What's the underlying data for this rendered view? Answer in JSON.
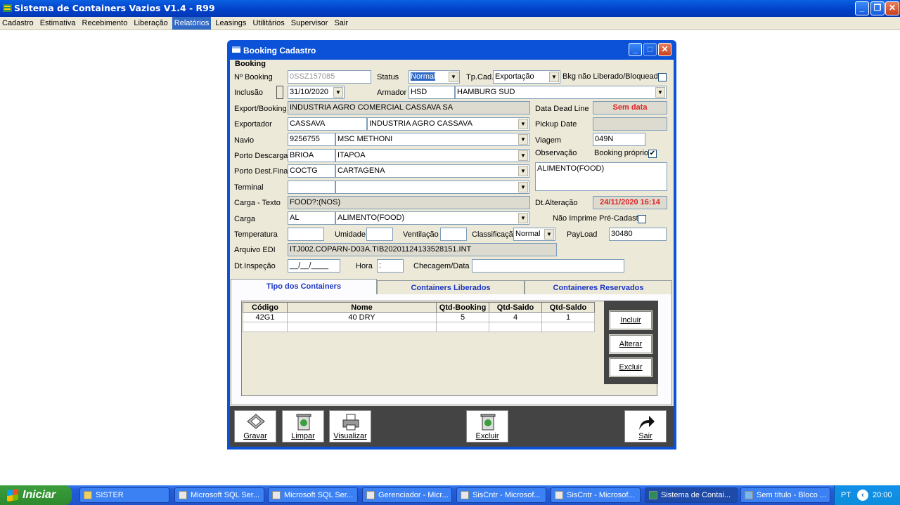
{
  "app": {
    "title": "Sistema de Containers Vazios V1.4 - R99"
  },
  "menu": [
    "Cadastro",
    "Estimativa",
    "Recebimento",
    "Liberação",
    "Relatórios",
    "Leasings",
    "Utilitários",
    "Supervisor",
    "Sair"
  ],
  "dialog": {
    "title": "Booking Cadastro",
    "group": "Booking"
  },
  "form": {
    "booking_label": "Nº Booking",
    "booking": "0SSZ157085",
    "status_label": "Status",
    "status": "Normal",
    "tpcad_label": "Tp.Cad.",
    "tpcad": "Exportação",
    "bkg_label": "Bkg não Liberado/Bloqueado",
    "inclusao_label": "Inclusão",
    "inclusao": "31/10/2020",
    "armador_label": "Armador",
    "armador_code": "HSD",
    "armador_name": "HAMBURG SUD",
    "export_label": "Export/Booking",
    "export": "INDUSTRIA AGRO COMERCIAL CASSAVA SA",
    "deadline_label": "Data Dead Line",
    "deadline": "Sem data",
    "exportador_label": "Exportador",
    "exportador_code": "CASSAVA",
    "exportador_name": "INDUSTRIA AGRO CASSAVA",
    "pickup_label": "Pickup Date",
    "navio_label": "Navio",
    "navio_code": "9256755",
    "navio_name": "MSC METHONI",
    "viagem_label": "Viagem",
    "viagem": "049N",
    "porto_desc_label": "Porto Descarga",
    "porto_desc_code": "BRIOA",
    "porto_desc_name": "ITAPOA",
    "obs_label": "Observação",
    "booking_proprio_label": "Booking próprio",
    "porto_dest_label": "Porto Dest.Final",
    "porto_dest_code": "COCTG",
    "porto_dest_name": "CARTAGENA",
    "obs": "ALIMENTO(FOOD)",
    "terminal_label": "Terminal",
    "carga_texto_label": "Carga - Texto",
    "carga_texto": "FOOD?:(NOS)",
    "dtalt_label": "Dt.Alteração",
    "dtalt": "24/11/2020 16:14",
    "carga_label": "Carga",
    "carga_code": "AL",
    "carga_name": "ALIMENTO(FOOD)",
    "nao_imprime_label": "Não Imprime Pré-Cadastro",
    "temp_label": "Temperatura",
    "umidade_label": "Umidade",
    "ventilacao_label": "Ventilação",
    "classif_label": "Classificação",
    "classif": "Normal",
    "payload_label": "PayLoad",
    "payload": "30480",
    "edi_label": "Arquivo EDI",
    "edi": "ITJ002.COPARN-D03A.TIB20201124133528151.INT",
    "dtinsp_label": "Dt.Inspeção",
    "dtinsp": "__/__/____",
    "hora_label": "Hora",
    "hora": " :",
    "checagem_label": "Checagem/Data"
  },
  "tabs": [
    "Tipo dos Containers",
    "Containers Liberados",
    "Containeres Reservados"
  ],
  "grid": {
    "headers": [
      "Código",
      "Nome",
      "Qtd-Booking",
      "Qtd-Saido",
      "Qtd-Saldo"
    ],
    "rows": [
      [
        "42G1",
        "40 DRY",
        "5",
        "4",
        "1"
      ]
    ]
  },
  "side_buttons": [
    "Incluir",
    "Alterar",
    "Excluir"
  ],
  "toolbar": [
    "Gravar",
    "Limpar",
    "Visualizar",
    "Excluir",
    "Sair"
  ],
  "taskbar": {
    "start": "Iniciar",
    "items": [
      "SISTER",
      "Microsoft SQL Ser...",
      "Microsoft SQL Ser...",
      "Gerenciador - Micr...",
      "SisCntr - Microsof...",
      "SisCntr - Microsof...",
      "Sistema de Contai...",
      "Sem título - Bloco ..."
    ],
    "lang": "PT",
    "clock": "20:00"
  }
}
